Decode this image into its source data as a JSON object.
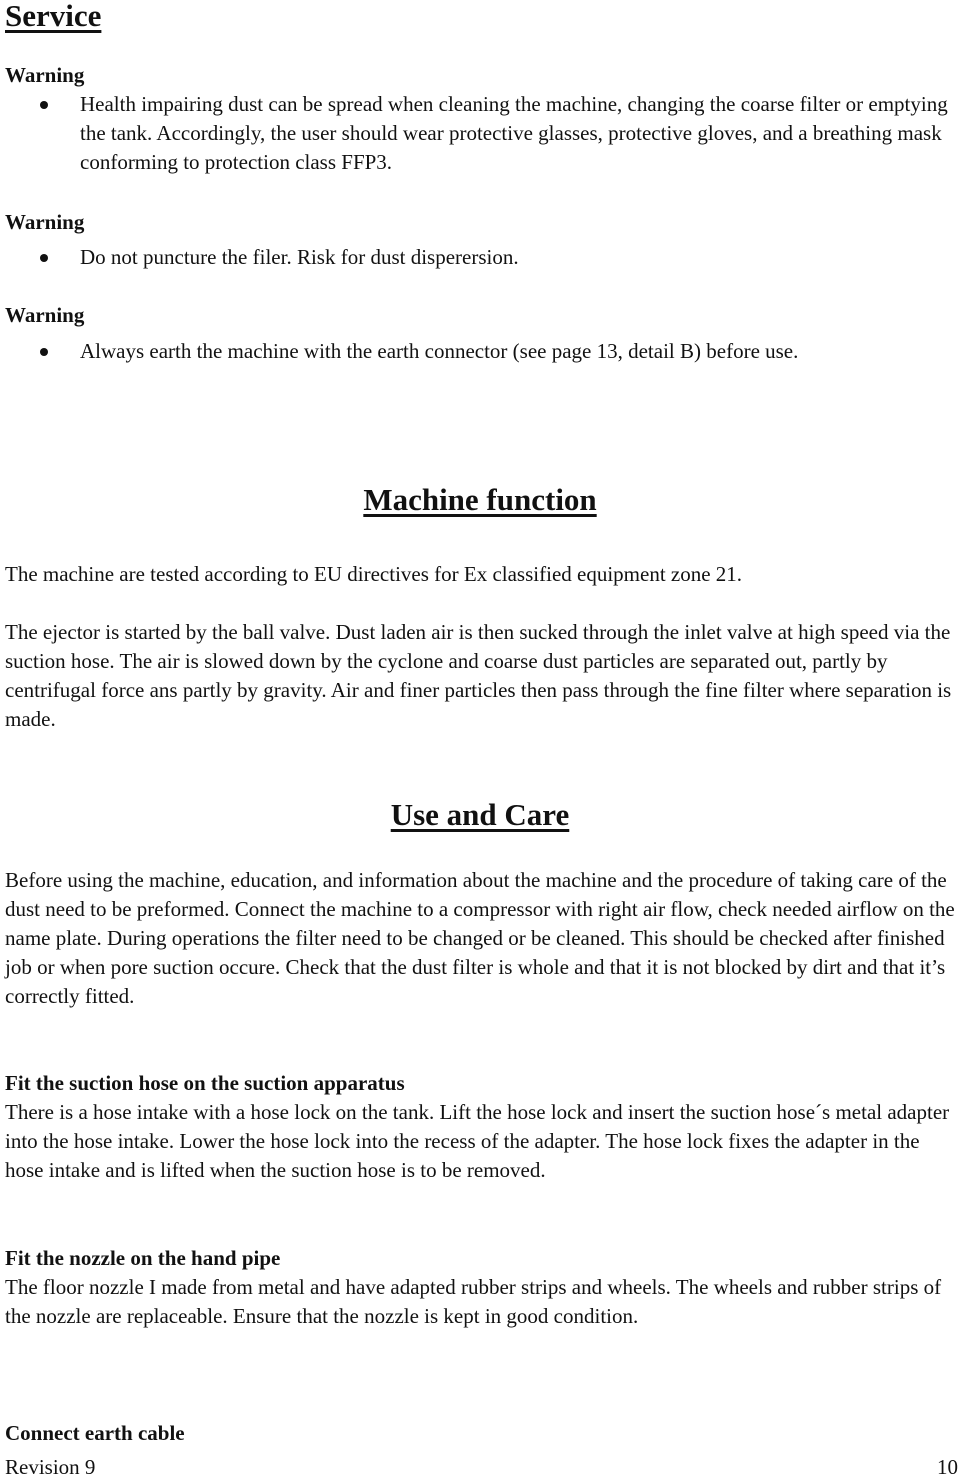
{
  "service": {
    "title": "Service",
    "warnings": [
      {
        "label": "Warning",
        "text": "Health impairing dust can be spread when cleaning the machine, changing the coarse filter or emptying the tank. Accordingly, the user should wear protective glasses, protective gloves, and a breathing mask conforming to protection class FFP3."
      },
      {
        "label": "Warning",
        "text": "Do not puncture the filer. Risk for dust disperersion."
      },
      {
        "label": "Warning",
        "text": "Always earth the machine with the earth connector (see page 13, detail B) before use."
      }
    ]
  },
  "machine_function": {
    "title": "Machine function",
    "paragraphs": [
      "The machine are tested according to EU directives for Ex classified equipment zone 21.",
      "The ejector is started by the ball valve. Dust laden air is then sucked through the inlet valve at high speed via the suction hose. The air is slowed down by the cyclone and coarse dust particles are separated out, partly by centrifugal force ans partly by gravity. Air and finer particles then pass through the fine filter where separation is made."
    ]
  },
  "use_and_care": {
    "title": "Use and Care",
    "intro": "Before using the machine, education, and information about the machine and the procedure of taking care of the dust need to be preformed. Connect the machine to a compressor with right air flow, check needed airflow on the name plate. During operations the filter need to be changed or be cleaned. This should be checked after finished job or when pore suction occure. Check that the dust filter is whole and that it is not blocked by dirt and that it’s correctly fitted.",
    "sections": [
      {
        "heading": "Fit the suction hose on the suction apparatus",
        "text": "There is a hose intake with a hose lock on the tank. Lift the hose lock and insert the suction hose´s metal adapter into the hose intake. Lower the hose lock into the recess of the adapter. The hose lock fixes the adapter in the hose intake and is lifted when the suction hose is to be removed."
      },
      {
        "heading": "Fit the nozzle on the hand pipe",
        "text": "The floor nozzle I made from metal and have adapted rubber strips and wheels. The wheels and rubber strips of the nozzle are replaceable. Ensure that the nozzle is kept in good condition."
      },
      {
        "heading": "Connect earth cable",
        "text": ""
      }
    ]
  },
  "footer": {
    "revision": "Revision 9",
    "page_number": "10"
  }
}
